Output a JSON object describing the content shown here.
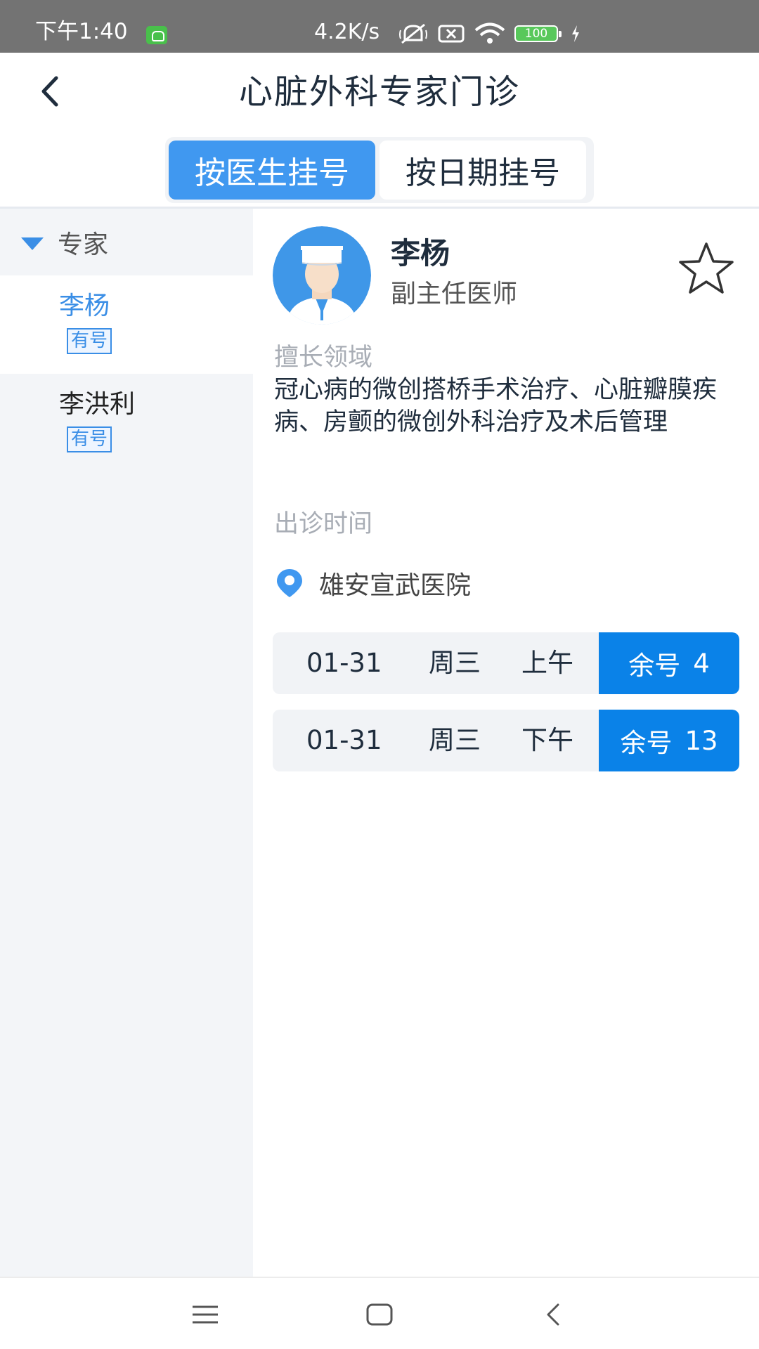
{
  "status_bar": {
    "time": "下午1:40",
    "network_speed": "4.2K/s",
    "battery": "100",
    "icons": [
      "app-notification-icon",
      "mute-vibrate-icon",
      "sim-x-icon",
      "wifi-icon",
      "battery-icon",
      "charging-icon"
    ]
  },
  "header": {
    "title": "心脏外科专家门诊",
    "back_icon": "back-chevron-icon"
  },
  "tabs": [
    {
      "label": "按医生挂号",
      "active": true
    },
    {
      "label": "按日期挂号",
      "active": false
    }
  ],
  "sidebar": {
    "section_title": "专家",
    "doctors": [
      {
        "name": "李杨",
        "badge": "有号",
        "selected": true
      },
      {
        "name": "李洪利",
        "badge": "有号",
        "selected": false
      }
    ]
  },
  "detail": {
    "doctor_name": "李杨",
    "doctor_title": "副主任医师",
    "specialty_label": "擅长领域",
    "specialty_text": "冠心病的微创搭桥手术治疗、心脏瓣膜疾病、房颤的微创外科治疗及术后管理",
    "schedule_label": "出诊时间",
    "hospital": "雄安宣武医院",
    "slots": [
      {
        "date": "01-31",
        "weekday": "周三",
        "period": "上午",
        "remaining_label": "余号",
        "remaining": "4"
      },
      {
        "date": "01-31",
        "weekday": "周三",
        "period": "下午",
        "remaining_label": "余号",
        "remaining": "13"
      }
    ]
  },
  "colors": {
    "accent": "#4098f0",
    "slot_button": "#0a82e8",
    "sidebar_bg": "#f3f5f8",
    "status_bar_bg": "#737373"
  }
}
